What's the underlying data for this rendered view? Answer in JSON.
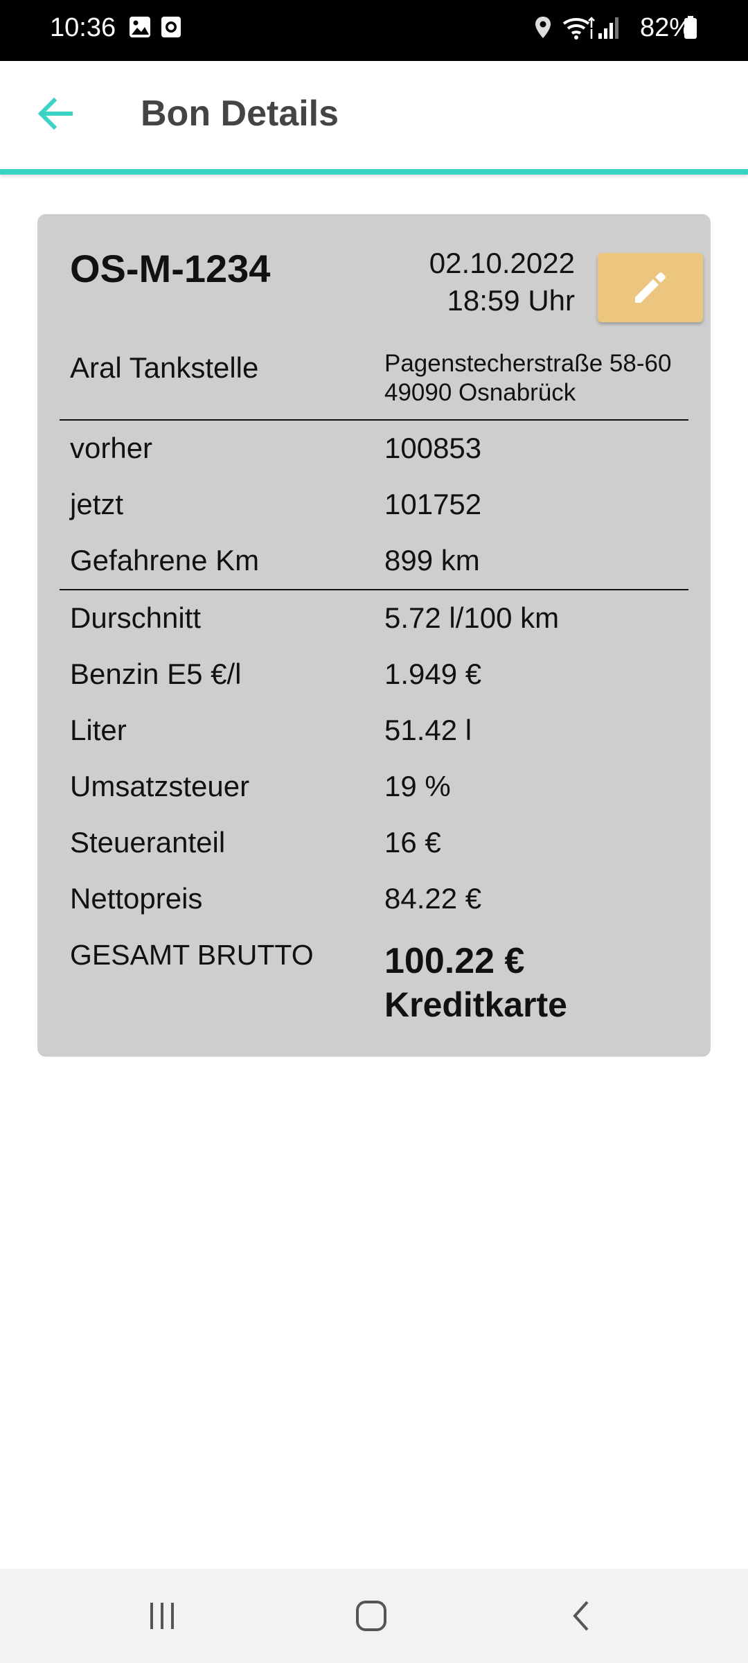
{
  "status_bar": {
    "time": "10:36",
    "battery_percent": "82%",
    "icons": [
      "image-icon",
      "screen-record-icon",
      "location-icon",
      "wifi-icon",
      "signal-icon",
      "battery-icon"
    ]
  },
  "app_bar": {
    "title": "Bon Details",
    "back_icon": "arrow-left-icon",
    "accent_color": "#3cd3c7"
  },
  "receipt": {
    "plate": "OS-M-1234",
    "date": "02.10.2022",
    "time": "18:59 Uhr",
    "edit_icon": "pencil-icon",
    "edit_color": "#ecc57e",
    "station": "Aral Tankstelle",
    "address_line1": "Pagenstecherstraße 58-60",
    "address_line2": "49090 Osnabrück",
    "rows": [
      {
        "label": "vorher",
        "value": "100853"
      },
      {
        "label": "jetzt",
        "value": "101752"
      },
      {
        "label": "Gefahrene Km",
        "value": "899 km"
      },
      {
        "label": "Durschnitt",
        "value": "5.72 l/100 km"
      },
      {
        "label": "Benzin E5 €/l",
        "value": "1.949 €"
      },
      {
        "label": "Liter",
        "value": "51.42 l"
      },
      {
        "label": "Umsatzsteuer",
        "value": "19 %"
      },
      {
        "label": "Steueranteil",
        "value": "16 €"
      },
      {
        "label": "Nettopreis",
        "value": "84.22 €"
      }
    ],
    "total_label": "GESAMT BRUTTO",
    "total_value": "100.22 €",
    "payment_method": "Kreditkarte"
  },
  "nav_bar": {
    "buttons": [
      "recent-apps-icon",
      "home-icon",
      "back-icon"
    ]
  }
}
